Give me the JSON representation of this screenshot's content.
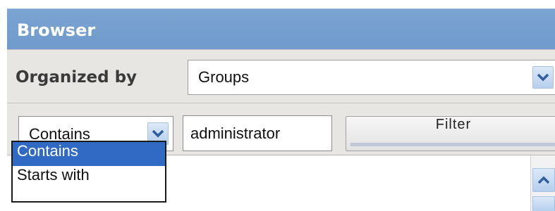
{
  "panel": {
    "title": "Browser"
  },
  "organize": {
    "label": "Organized by",
    "selected": "Groups"
  },
  "filter": {
    "mode_selected": "Contains",
    "input_value": "administrator",
    "button_label": "Filter"
  },
  "mode_dropdown": {
    "open": true,
    "options": [
      "Contains",
      "Starts with"
    ],
    "highlighted": "Contains"
  },
  "icons": {
    "organize_dropdown": "chevron-down-icon",
    "mode_dropdown": "chevron-down-icon",
    "scroll_up": "chevron-up-icon"
  },
  "colors": {
    "titlebar": "#7ba4d2",
    "highlight": "#316ac5",
    "toolbar": "#e7e6e2"
  }
}
